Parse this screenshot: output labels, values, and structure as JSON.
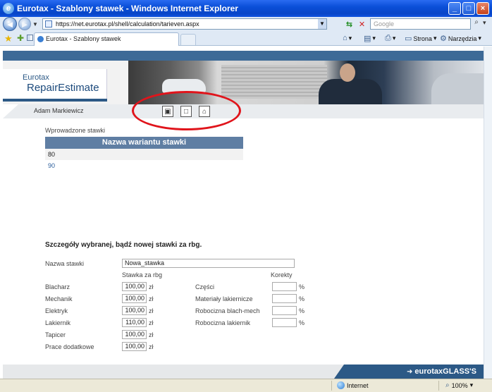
{
  "window": {
    "title": "Eurotax - Szablony stawek - Windows Internet Explorer",
    "logo_letter": "e",
    "minimize": "_",
    "maximize": "□",
    "close": "×"
  },
  "addressbar": {
    "url": "https://net.eurotax.pl/shell/calculation/tarieven.aspx",
    "search_placeholder": "Google",
    "back": "◄",
    "forward": "►"
  },
  "tabs": {
    "active_label": "Eurotax - Szablony stawek"
  },
  "commandbar": {
    "home_icon": "⌂",
    "feeds_icon": "▤",
    "print_icon": "⎙",
    "page_label": "Strona",
    "tools_label": "Narzędzia"
  },
  "app": {
    "logo_top": "Eurotax",
    "logo_main": "RepairEstimate",
    "user_name": "Adam Markiewicz",
    "toolbar": {
      "save_icon": "▣",
      "new_icon": "□",
      "home_icon": "⌂"
    }
  },
  "variants": {
    "section_label": "Wprowadzone stawki",
    "header": "Nazwa wariantu stawki",
    "rows": [
      "80",
      "90"
    ]
  },
  "details": {
    "title": "Szczegóły wybranej, bądź nowej stawki za rbg.",
    "name_label": "Nazwa stawki",
    "name_value": "Nowa_stawka",
    "rate_header": "Stawka za rbg",
    "corrections_header": "Korekty",
    "currency": "zł",
    "percent": "%",
    "rates": [
      {
        "label": "Blacharz",
        "value": "100,00"
      },
      {
        "label": "Mechanik",
        "value": "100,00"
      },
      {
        "label": "Elektryk",
        "value": "100,00"
      },
      {
        "label": "Lakiernik",
        "value": "110,00"
      },
      {
        "label": "Tapicer",
        "value": "100,00"
      },
      {
        "label": "Prace dodatkowe",
        "value": "100,00"
      }
    ],
    "corrections": [
      {
        "label": "Części",
        "value": ""
      },
      {
        "label": "Materiały lakiernicze",
        "value": ""
      },
      {
        "label": "Robocizna blach-mech",
        "value": ""
      },
      {
        "label": "Robocizna lakiernik",
        "value": ""
      }
    ]
  },
  "footer": {
    "brand": "eurotaxGLASS'S"
  },
  "statusbar": {
    "zone": "Internet",
    "zoom": "100%"
  },
  "colors": {
    "brand_blue": "#2c5986",
    "table_header": "#5f7ea3",
    "highlight_red": "#e0141b"
  }
}
